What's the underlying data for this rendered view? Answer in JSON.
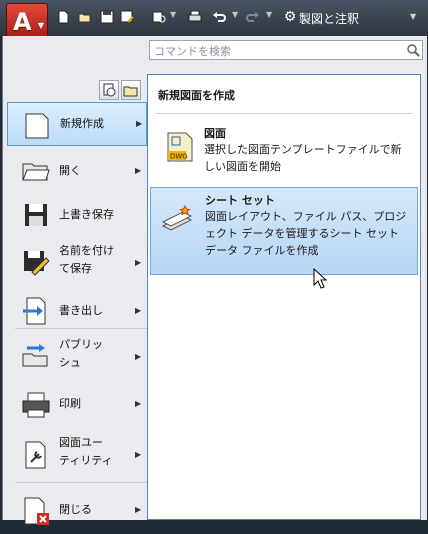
{
  "app_button": {
    "letter": "A",
    "icon": "autocad-logo"
  },
  "quick_access": {
    "icons": [
      "new-icon",
      "open-icon",
      "save-icon",
      "save-as-icon",
      "plot-preview-icon",
      "plot-icon",
      "undo-icon",
      "redo-icon"
    ],
    "workspace_label": "製図と注釈"
  },
  "search": {
    "placeholder": "コマンドを検索"
  },
  "left_menu": [
    {
      "label": "新規作成",
      "has_arrow": true,
      "active": true,
      "icon": "new-document-icon"
    },
    {
      "label": "開く",
      "has_arrow": true,
      "icon": "open-folder-icon"
    },
    {
      "label": "上書き保存",
      "has_arrow": false,
      "icon": "save-icon"
    },
    {
      "label": "名前を付け\nて保存",
      "has_arrow": true,
      "icon": "save-as-icon"
    },
    {
      "label": "書き出し",
      "has_arrow": true,
      "icon": "export-icon"
    },
    {
      "label": "パブリッ\nシュ",
      "has_arrow": true,
      "icon": "publish-icon"
    },
    {
      "label": "印刷",
      "has_arrow": true,
      "icon": "print-icon"
    },
    {
      "label": "図面ユー\nティリティ",
      "has_arrow": true,
      "icon": "drawing-utilities-icon"
    },
    {
      "label": "閉じる",
      "has_arrow": true,
      "icon": "close-document-icon"
    }
  ],
  "right_panel": {
    "title": "新規図面を作成",
    "items": [
      {
        "title": "図面",
        "description": "選択した図面テンプレートファイルで新しい図面を開始",
        "icon": "dwg-icon"
      },
      {
        "title": "シート セット",
        "description": "図面レイアウト、ファイル パス、プロジェクト データを管理するシート セット データ ファイルを作成",
        "icon": "sheet-set-icon"
      }
    ]
  },
  "colors": {
    "accent_blue": "#5d97cc",
    "app_red": "#c9302c"
  }
}
